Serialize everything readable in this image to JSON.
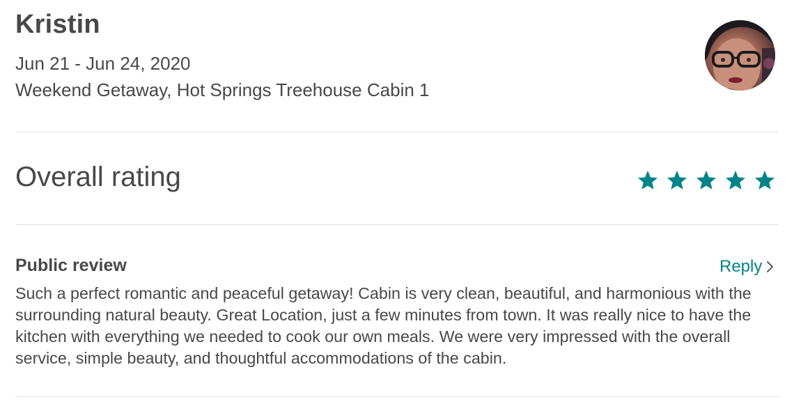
{
  "guest": {
    "name": "Kristin",
    "dates": "Jun 21 - Jun 24, 2020",
    "listing": "Weekend Getaway, Hot Springs Treehouse Cabin 1",
    "avatar_icon": "guest-avatar-photo"
  },
  "rating": {
    "label": "Overall rating",
    "stars": 5,
    "max_stars": 5,
    "star_color": "#008489"
  },
  "public_review": {
    "title": "Public review",
    "reply_label": "Reply",
    "reply_icon": "chevron-right-icon",
    "text": "Such a perfect romantic and peaceful getaway! Cabin is very clean, beautiful, and harmonious with the surrounding natural beauty. Great Location, just a few minutes from town. It was really nice to have the kitchen with everything we needed to cook our own meals. We were very impressed with the overall service, simple beauty, and thoughtful accommodations of the cabin."
  },
  "colors": {
    "text": "#484848",
    "accent": "#008489",
    "divider": "#e4e4e4"
  }
}
